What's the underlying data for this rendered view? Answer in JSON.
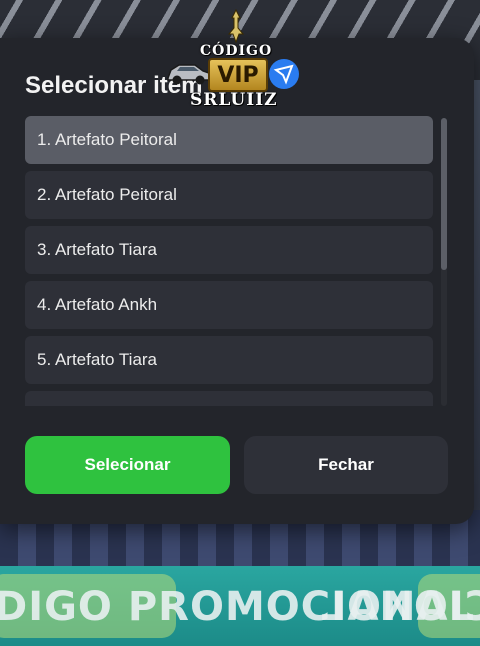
{
  "dialog": {
    "title": "Selecionar item",
    "items": [
      {
        "label": "1. Artefato Peitoral",
        "selected": true
      },
      {
        "label": "2. Artefato Peitoral",
        "selected": false
      },
      {
        "label": "3. Artefato Tiara",
        "selected": false
      },
      {
        "label": "4. Artefato Ankh",
        "selected": false
      },
      {
        "label": "5. Artefato Tiara",
        "selected": false
      }
    ],
    "select_label": "Selecionar",
    "close_label": "Fechar"
  },
  "watermark": {
    "line1": "CÓDIGO",
    "badge": "VIP",
    "line2": "SRLUIIZ"
  },
  "banner": {
    "text": "DIGO PROMOCIONAL",
    "mirror_text": "PROMOCIONAL"
  },
  "colors": {
    "accent_green": "#2fc23f",
    "dialog_bg": "#23252b",
    "item_bg": "#2e3038",
    "item_selected_bg": "#5a5d66"
  }
}
